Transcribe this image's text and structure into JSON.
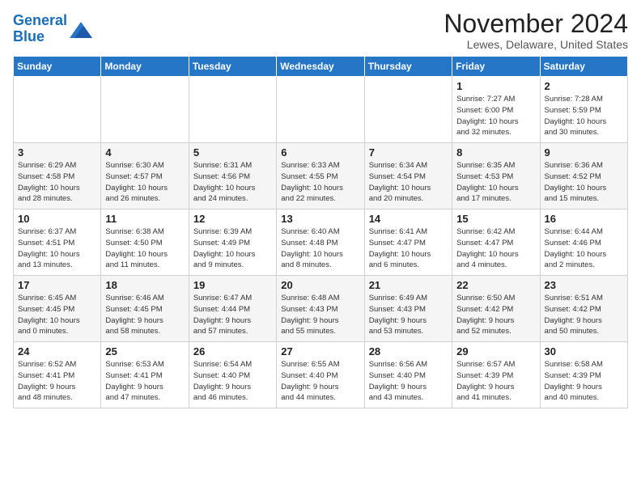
{
  "logo": {
    "line1": "General",
    "line2": "Blue"
  },
  "title": "November 2024",
  "subtitle": "Lewes, Delaware, United States",
  "header": {
    "accent_color": "#2676c8"
  },
  "days_of_week": [
    "Sunday",
    "Monday",
    "Tuesday",
    "Wednesday",
    "Thursday",
    "Friday",
    "Saturday"
  ],
  "weeks": [
    [
      {
        "day": "",
        "info": ""
      },
      {
        "day": "",
        "info": ""
      },
      {
        "day": "",
        "info": ""
      },
      {
        "day": "",
        "info": ""
      },
      {
        "day": "",
        "info": ""
      },
      {
        "day": "1",
        "info": "Sunrise: 7:27 AM\nSunset: 6:00 PM\nDaylight: 10 hours\nand 32 minutes."
      },
      {
        "day": "2",
        "info": "Sunrise: 7:28 AM\nSunset: 5:59 PM\nDaylight: 10 hours\nand 30 minutes."
      }
    ],
    [
      {
        "day": "3",
        "info": "Sunrise: 6:29 AM\nSunset: 4:58 PM\nDaylight: 10 hours\nand 28 minutes."
      },
      {
        "day": "4",
        "info": "Sunrise: 6:30 AM\nSunset: 4:57 PM\nDaylight: 10 hours\nand 26 minutes."
      },
      {
        "day": "5",
        "info": "Sunrise: 6:31 AM\nSunset: 4:56 PM\nDaylight: 10 hours\nand 24 minutes."
      },
      {
        "day": "6",
        "info": "Sunrise: 6:33 AM\nSunset: 4:55 PM\nDaylight: 10 hours\nand 22 minutes."
      },
      {
        "day": "7",
        "info": "Sunrise: 6:34 AM\nSunset: 4:54 PM\nDaylight: 10 hours\nand 20 minutes."
      },
      {
        "day": "8",
        "info": "Sunrise: 6:35 AM\nSunset: 4:53 PM\nDaylight: 10 hours\nand 17 minutes."
      },
      {
        "day": "9",
        "info": "Sunrise: 6:36 AM\nSunset: 4:52 PM\nDaylight: 10 hours\nand 15 minutes."
      }
    ],
    [
      {
        "day": "10",
        "info": "Sunrise: 6:37 AM\nSunset: 4:51 PM\nDaylight: 10 hours\nand 13 minutes."
      },
      {
        "day": "11",
        "info": "Sunrise: 6:38 AM\nSunset: 4:50 PM\nDaylight: 10 hours\nand 11 minutes."
      },
      {
        "day": "12",
        "info": "Sunrise: 6:39 AM\nSunset: 4:49 PM\nDaylight: 10 hours\nand 9 minutes."
      },
      {
        "day": "13",
        "info": "Sunrise: 6:40 AM\nSunset: 4:48 PM\nDaylight: 10 hours\nand 8 minutes."
      },
      {
        "day": "14",
        "info": "Sunrise: 6:41 AM\nSunset: 4:47 PM\nDaylight: 10 hours\nand 6 minutes."
      },
      {
        "day": "15",
        "info": "Sunrise: 6:42 AM\nSunset: 4:47 PM\nDaylight: 10 hours\nand 4 minutes."
      },
      {
        "day": "16",
        "info": "Sunrise: 6:44 AM\nSunset: 4:46 PM\nDaylight: 10 hours\nand 2 minutes."
      }
    ],
    [
      {
        "day": "17",
        "info": "Sunrise: 6:45 AM\nSunset: 4:45 PM\nDaylight: 10 hours\nand 0 minutes."
      },
      {
        "day": "18",
        "info": "Sunrise: 6:46 AM\nSunset: 4:45 PM\nDaylight: 9 hours\nand 58 minutes."
      },
      {
        "day": "19",
        "info": "Sunrise: 6:47 AM\nSunset: 4:44 PM\nDaylight: 9 hours\nand 57 minutes."
      },
      {
        "day": "20",
        "info": "Sunrise: 6:48 AM\nSunset: 4:43 PM\nDaylight: 9 hours\nand 55 minutes."
      },
      {
        "day": "21",
        "info": "Sunrise: 6:49 AM\nSunset: 4:43 PM\nDaylight: 9 hours\nand 53 minutes."
      },
      {
        "day": "22",
        "info": "Sunrise: 6:50 AM\nSunset: 4:42 PM\nDaylight: 9 hours\nand 52 minutes."
      },
      {
        "day": "23",
        "info": "Sunrise: 6:51 AM\nSunset: 4:42 PM\nDaylight: 9 hours\nand 50 minutes."
      }
    ],
    [
      {
        "day": "24",
        "info": "Sunrise: 6:52 AM\nSunset: 4:41 PM\nDaylight: 9 hours\nand 48 minutes."
      },
      {
        "day": "25",
        "info": "Sunrise: 6:53 AM\nSunset: 4:41 PM\nDaylight: 9 hours\nand 47 minutes."
      },
      {
        "day": "26",
        "info": "Sunrise: 6:54 AM\nSunset: 4:40 PM\nDaylight: 9 hours\nand 46 minutes."
      },
      {
        "day": "27",
        "info": "Sunrise: 6:55 AM\nSunset: 4:40 PM\nDaylight: 9 hours\nand 44 minutes."
      },
      {
        "day": "28",
        "info": "Sunrise: 6:56 AM\nSunset: 4:40 PM\nDaylight: 9 hours\nand 43 minutes."
      },
      {
        "day": "29",
        "info": "Sunrise: 6:57 AM\nSunset: 4:39 PM\nDaylight: 9 hours\nand 41 minutes."
      },
      {
        "day": "30",
        "info": "Sunrise: 6:58 AM\nSunset: 4:39 PM\nDaylight: 9 hours\nand 40 minutes."
      }
    ]
  ]
}
